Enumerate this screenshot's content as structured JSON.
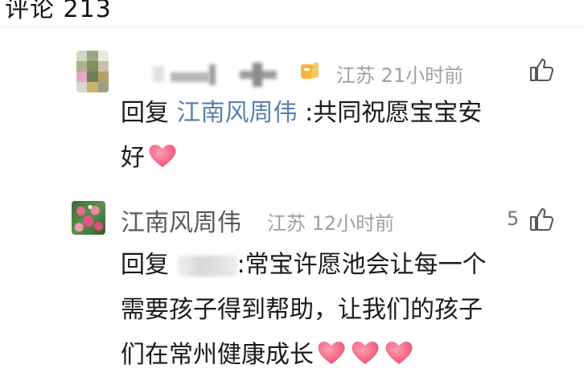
{
  "header": {
    "partial_text": "评论 213"
  },
  "comments": [
    {
      "id": "reply-1",
      "avatar": "mosaic-blurred-avatar",
      "username_hidden": true,
      "badge_icon": "level-badge-icon",
      "location": "江苏",
      "time": "21小时前",
      "likes": "",
      "reply_prefix": "回复",
      "reply_target": "江南风周伟",
      "text_line1": " :共同祝愿宝宝安",
      "text_line2": "好",
      "emoji_count": 1
    },
    {
      "id": "reply-2",
      "avatar": "flower-avatar",
      "username": "江南风周伟",
      "location": "江苏",
      "time": "12小时前",
      "likes": "5",
      "reply_prefix": "回复",
      "reply_target_hidden": true,
      "text_line1": ":常宝许愿池会让每一个",
      "text_line2": "需要孩子得到帮助，让我们的孩子",
      "text_line3": "们在常州健康成长",
      "emoji_count": 3
    }
  ],
  "colors": {
    "link": "#5a7fb0",
    "meta": "#a0a0a0",
    "heart": "#f25a7c",
    "badge": "#f5b73b"
  }
}
